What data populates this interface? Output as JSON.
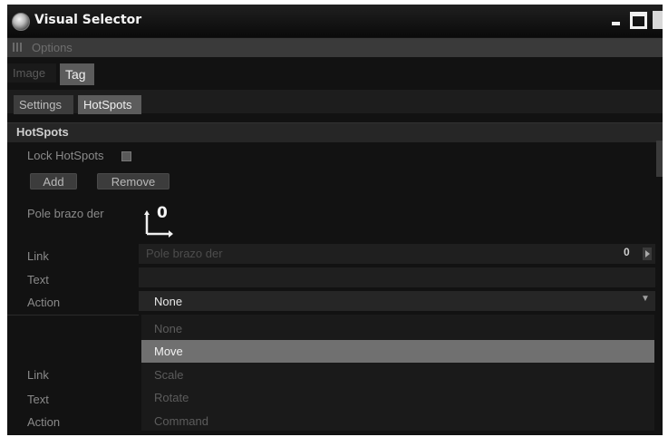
{
  "window": {
    "title": "Visual Selector"
  },
  "menubar": {
    "items": [
      "Options"
    ]
  },
  "tabs_main": [
    {
      "label": "Image",
      "active": false
    },
    {
      "label": "Tag",
      "active": true
    }
  ],
  "tabs_sub": [
    {
      "label": "Settings",
      "active": false
    },
    {
      "label": "HotSpots",
      "active": true
    }
  ],
  "section": {
    "title": "HotSpots",
    "lock_label": "Lock HotSpots",
    "lock_checked": false,
    "add_label": "Add",
    "remove_label": "Remove"
  },
  "hotspot": {
    "name": "Pole brazo der",
    "ref_value": "0",
    "link_label": "Link",
    "link_value": "Pole brazo der",
    "link_icon_value": "0",
    "text_label": "Text",
    "text_value": "",
    "action_label": "Action",
    "action_value": "None"
  },
  "action_dropdown": {
    "options": [
      "None",
      "Move",
      "Scale",
      "Rotate",
      "Command"
    ],
    "highlighted": "Move"
  },
  "hotspot2": {
    "link_label": "Link",
    "text_label": "Text",
    "action_label": "Action"
  },
  "colors": {
    "background": "#121212",
    "highlight": "#707070",
    "text": "#9a9a9a"
  }
}
